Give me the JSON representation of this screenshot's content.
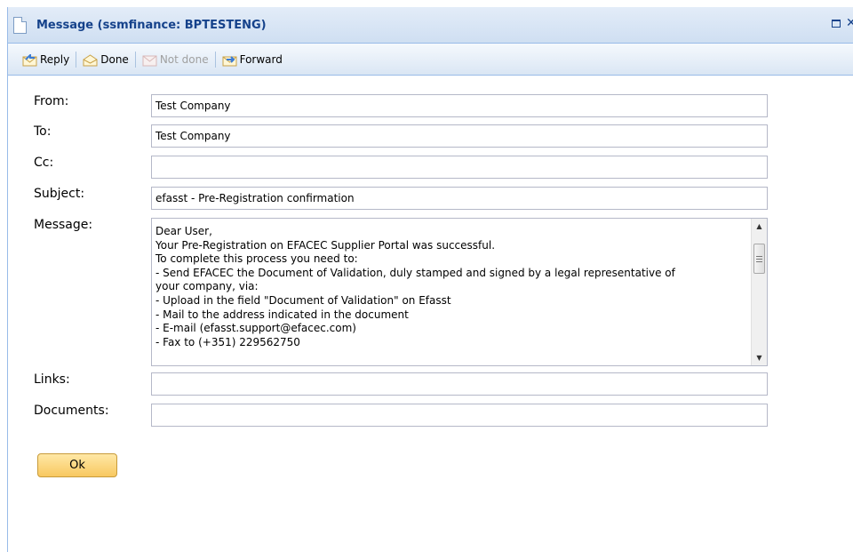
{
  "window": {
    "title": "Message (ssmfinance: BPTESTENG)"
  },
  "toolbar": {
    "reply_label": "Reply",
    "done_label": "Done",
    "not_done_label": "Not done",
    "forward_label": "Forward"
  },
  "form": {
    "from": {
      "label": "From:",
      "value": "Test Company"
    },
    "to": {
      "label": "To:",
      "value": "Test Company"
    },
    "cc": {
      "label": "Cc:",
      "value": ""
    },
    "subject": {
      "label": "Subject:",
      "value": "efasst - Pre-Registration confirmation"
    },
    "message": {
      "label": "Message:",
      "lines": [
        "Dear User,",
        "Your Pre-Registration on EFACEC Supplier Portal was successful.",
        "To complete this process you need to:",
        "- Send EFACEC the Document of Validation, duly stamped and signed by a legal representative of",
        "your company, via:",
        "- Upload in the field \"Document of Validation\" on Efasst",
        "- Mail to the address indicated in the document",
        "- E-mail (efasst.support@efacec.com)",
        "- Fax to (+351) 229562750"
      ]
    },
    "links": {
      "label": "Links:",
      "value": ""
    },
    "documents": {
      "label": "Documents:",
      "value": ""
    }
  },
  "ok_label": "Ok"
}
